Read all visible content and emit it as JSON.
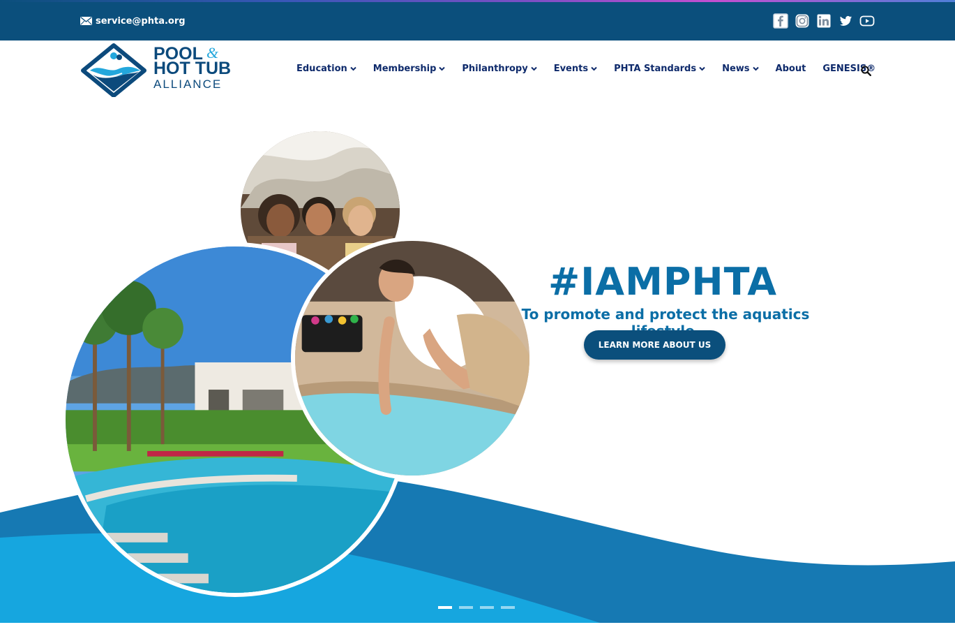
{
  "topbar": {
    "email": "service@phta.org",
    "email_icon": "envelope-icon",
    "socials": [
      "facebook-icon",
      "instagram-icon",
      "linkedin-icon",
      "twitter-icon",
      "youtube-icon"
    ]
  },
  "logo": {
    "line1": "POOL",
    "amp": "&",
    "line2": "HOT TUB",
    "line3": "ALLIANCE"
  },
  "nav": {
    "items": [
      {
        "label": "Education",
        "dropdown": true
      },
      {
        "label": "Membership",
        "dropdown": true
      },
      {
        "label": "Philanthropy",
        "dropdown": true
      },
      {
        "label": "Events",
        "dropdown": true
      },
      {
        "label": "PHTA Standards",
        "dropdown": true
      },
      {
        "label": "News",
        "dropdown": true
      },
      {
        "label": "About",
        "dropdown": false
      },
      {
        "label": "GENESIS®",
        "dropdown": false
      }
    ],
    "search_icon": "search-icon"
  },
  "hero": {
    "title": "#IAMPHTA",
    "subtitle": "To promote and protect the aquatics lifestyle.",
    "button": "LEARN MORE ABOUT US",
    "slides": 4,
    "active_slide": 1
  },
  "colors": {
    "topbar": "#0b4f7c",
    "nav_text": "#0e2a6b",
    "accent": "#0b6ea6",
    "wave_dark": "#1679b3",
    "wave_light": "#16a6df"
  }
}
